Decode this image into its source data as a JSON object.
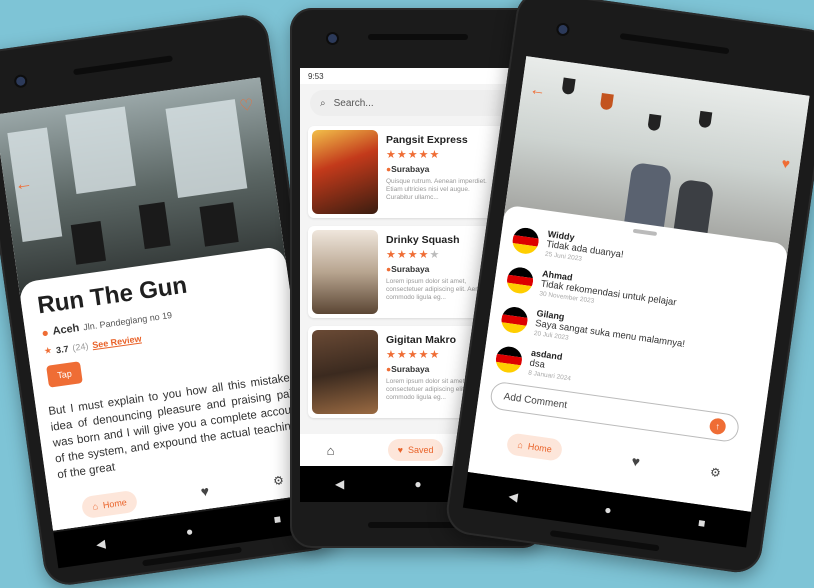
{
  "colors": {
    "accent": "#ef6d35",
    "background": "#7ec4d6"
  },
  "detail": {
    "title": "Run The Gun",
    "city": "Aceh",
    "address": "Jln. Pandeglang no 19",
    "rating": "3.7",
    "reviews_count": "(24)",
    "see_review": "See Review",
    "button_label": "Tap",
    "description": "But I must explain to you how all this mistaken idea of denouncing pleasure and praising pain was born and I will give you a complete account of the system, and expound the actual teachings of the great",
    "nav": {
      "home": "Home"
    }
  },
  "list": {
    "status_time": "9:53",
    "search_placeholder": "Search...",
    "restaurants": [
      {
        "name": "Pangsit Express",
        "stars": "★★★★★",
        "stars_off": "",
        "city": "Surabaya",
        "desc": "Quisque rutrum. Aenean imperdiet. Etiam ultricies nisi vel augue. Curabitur ullamc..."
      },
      {
        "name": "Drinky Squash",
        "stars": "★★★★",
        "stars_off": "★",
        "city": "Surabaya",
        "desc": "Lorem ipsum dolor sit amet, consectetuer adipiscing elit. Aenean commodo ligula eg..."
      },
      {
        "name": "Gigitan Makro",
        "stars": "★★★★★",
        "stars_off": "",
        "city": "Surabaya",
        "desc": "Lorem ipsum dolor sit amet, consectetuer adipiscing elit. Aenean commodo ligula eg..."
      }
    ],
    "nav": {
      "saved": "Saved"
    }
  },
  "comments": {
    "items": [
      {
        "name": "Widdy",
        "text": "Tidak ada duanya!",
        "date": "25 Juni 2023"
      },
      {
        "name": "Ahmad",
        "text": "Tidak rekomendasi untuk pelajar",
        "date": "30 November 2023"
      },
      {
        "name": "Gilang",
        "text": "Saya sangat suka menu malamnya!",
        "date": "20 Juli 2023"
      },
      {
        "name": "asdand",
        "text": "dsa",
        "date": "8 Januari 2024"
      }
    ],
    "add_placeholder": "Add Comment",
    "nav": {
      "home": "Home"
    }
  }
}
